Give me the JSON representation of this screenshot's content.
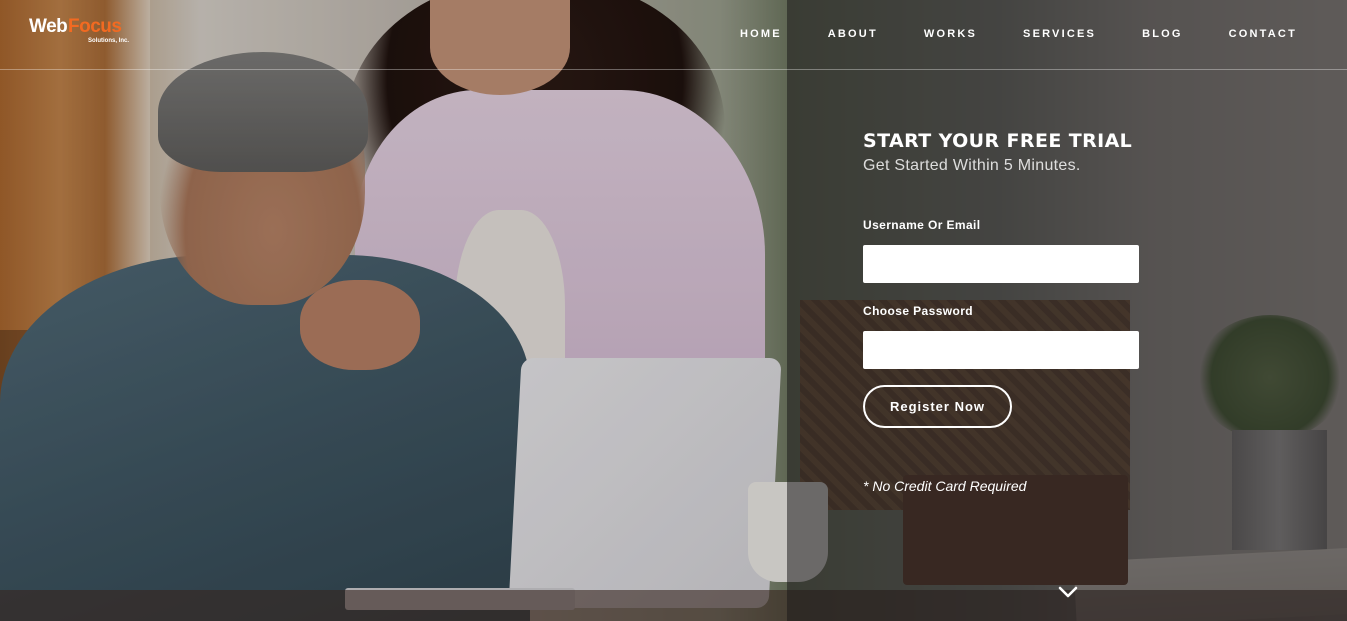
{
  "logo": {
    "part1": "Web",
    "part2": "Focus",
    "tagline": "Solutions, Inc."
  },
  "nav": {
    "items": [
      "HOME",
      "ABOUT",
      "WORKS",
      "SERVICES",
      "BLOG",
      "CONTACT"
    ]
  },
  "signup": {
    "title": "START YOUR FREE TRIAL",
    "subtitle": "Get Started Within 5 Minutes.",
    "username_label": "Username Or Email",
    "username_value": "",
    "password_label": "Choose Password",
    "password_value": "",
    "submit_label": "Register Now",
    "note": "* No Credit Card Required"
  },
  "scroll": {
    "icon": "chevron-down-icon"
  },
  "colors": {
    "brand_accent": "#f26a21",
    "text": "#ffffff",
    "panel_overlay": "#1a1618"
  }
}
